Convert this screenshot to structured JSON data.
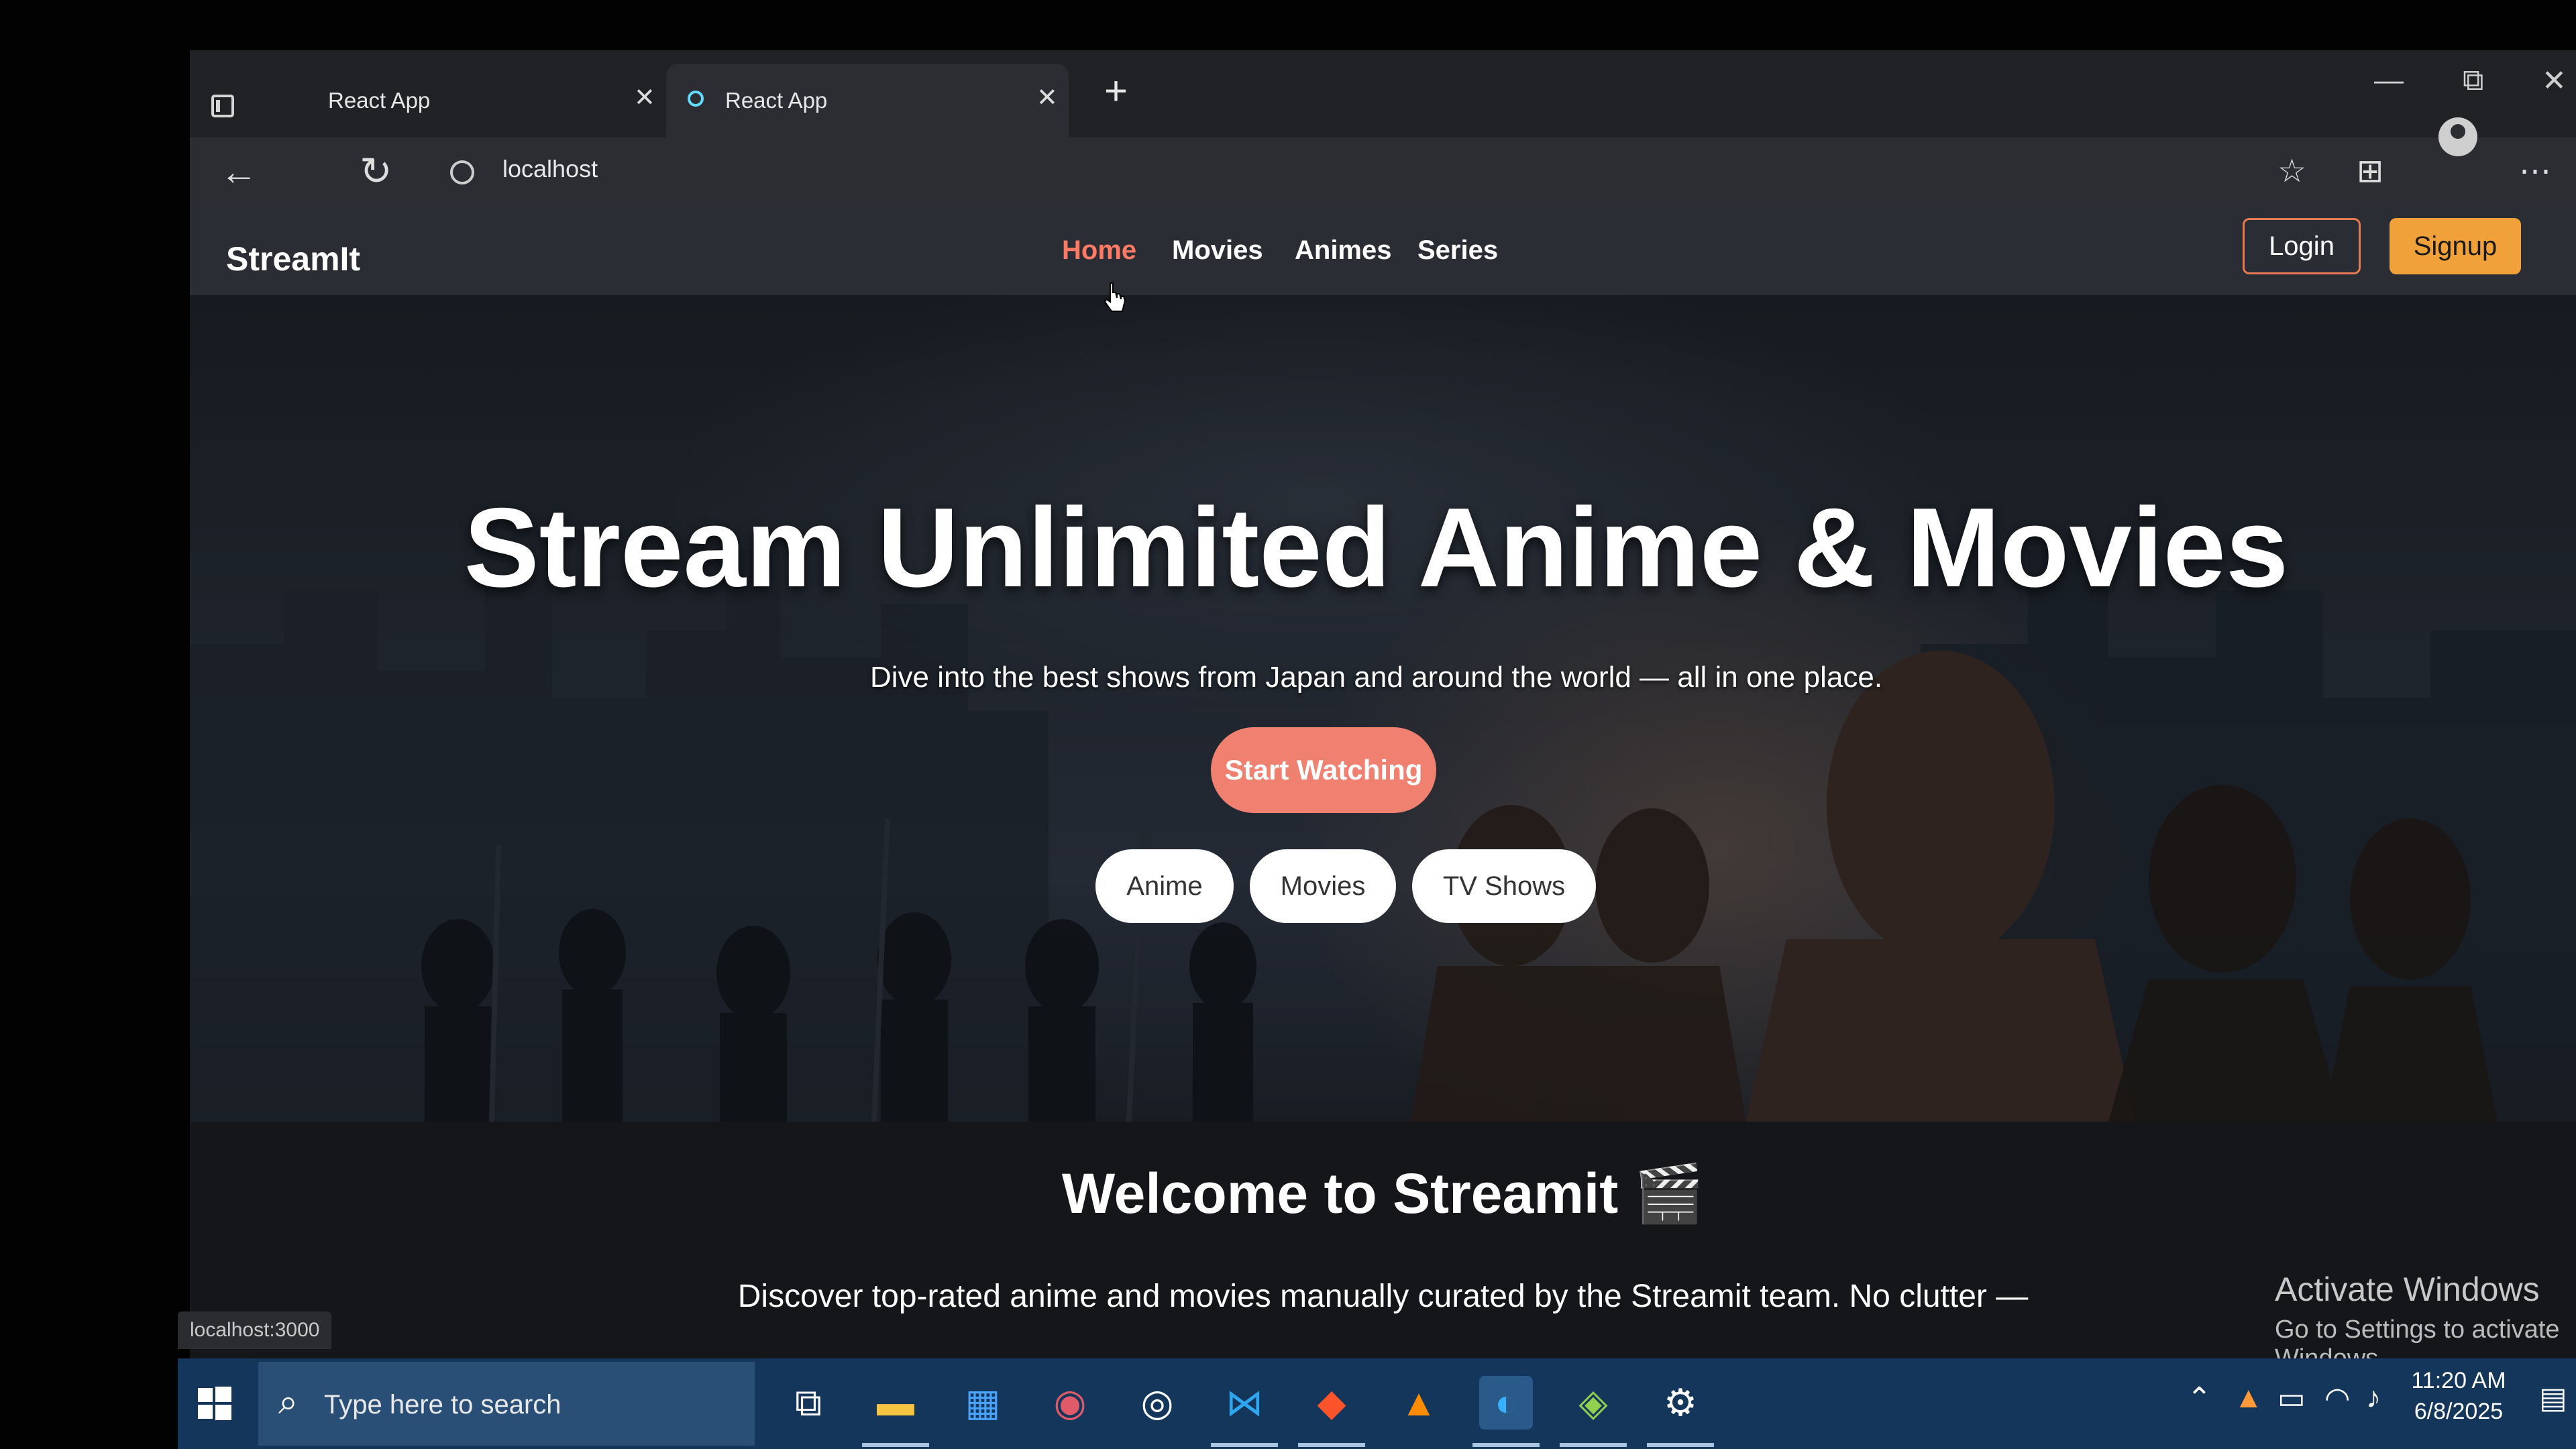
{
  "browser": {
    "tabs": [
      {
        "title": "React App"
      },
      {
        "title": "React App"
      }
    ],
    "tab_close_glyph": "✕",
    "new_tab_glyph": "+",
    "address": "localhost",
    "status_url": "localhost:3000",
    "window_controls": {
      "minimize": "—",
      "restore": "⧉",
      "close": "✕"
    }
  },
  "navbar": {
    "brand": "StreamIt",
    "links": [
      {
        "label": "Home",
        "active": true
      },
      {
        "label": "Movies"
      },
      {
        "label": "Animes"
      },
      {
        "label": "Series"
      }
    ],
    "login": "Login",
    "signup": "Signup"
  },
  "hero": {
    "title": "Stream Unlimited Anime & Movies",
    "subtitle": "Dive into the best shows from Japan and around the world — all in one place.",
    "cta": "Start Watching",
    "pills": [
      "Anime",
      "Movies",
      "TV Shows"
    ]
  },
  "welcome": {
    "title": "Welcome to Streamit 🎬",
    "text": "Discover top-rated anime and movies manually curated by the Streamit team. No clutter —"
  },
  "activate": {
    "title": "Activate Windows",
    "subtitle": "Go to Settings to activate Windows."
  },
  "taskbar": {
    "search_placeholder": "Type here to search",
    "time": "11:20 AM",
    "date": "6/8/2025"
  },
  "colors": {
    "accent": "#f08070",
    "nav_active": "#ff7a65",
    "signup": "#f0a13a",
    "taskbar": "#14365a"
  }
}
